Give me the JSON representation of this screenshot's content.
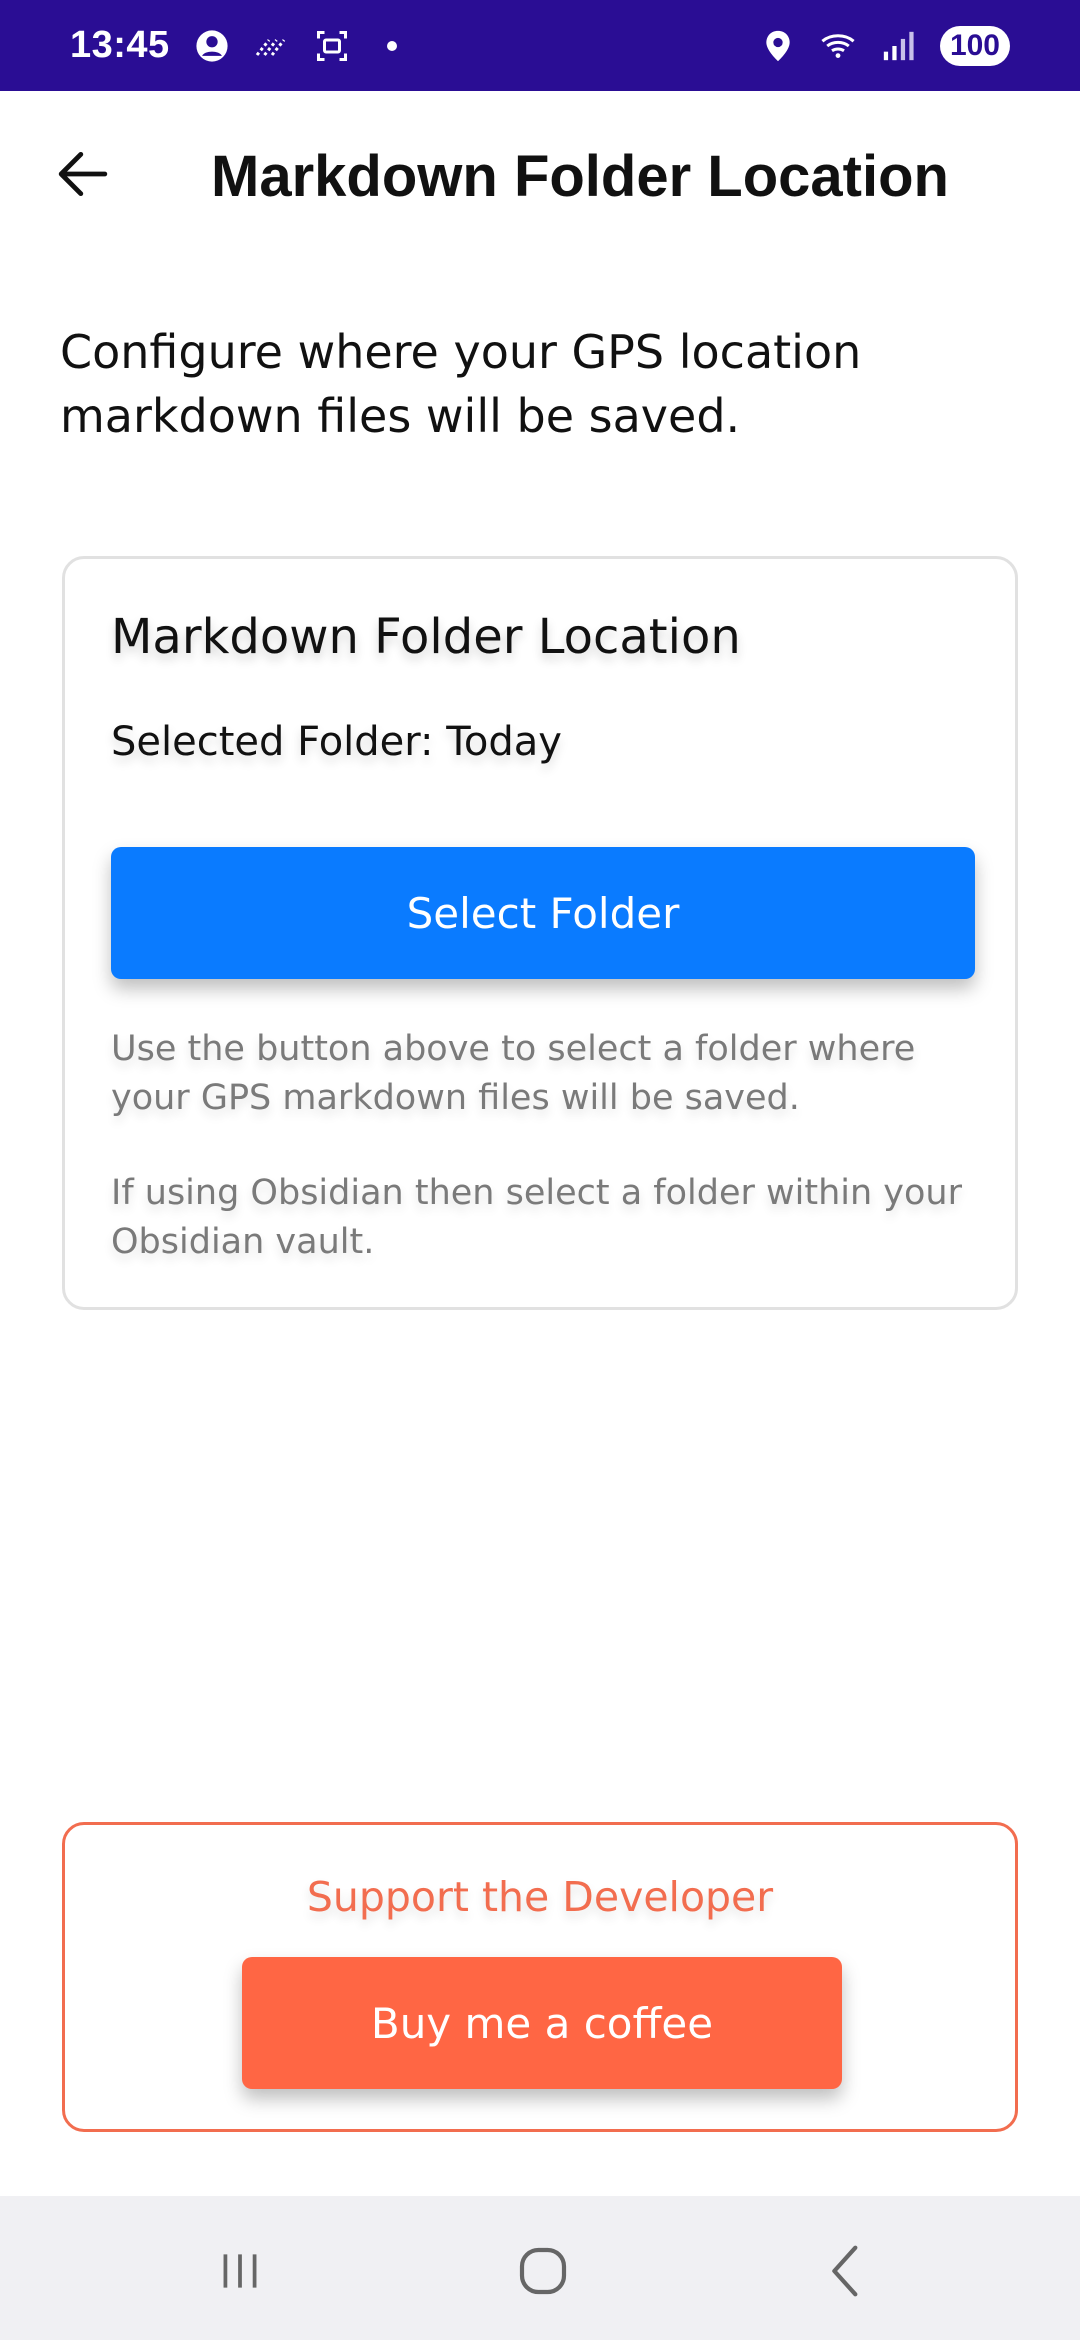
{
  "status_bar": {
    "time": "13:45",
    "battery": "100",
    "icons": [
      "account-circle-icon",
      "wifi-calling-icon",
      "screenshot-icon",
      "dot-icon",
      "location-icon",
      "wifi-icon",
      "signal-icon"
    ]
  },
  "header": {
    "title": "Markdown Folder Location",
    "back_icon": "arrow-left-icon"
  },
  "description": "Configure where your GPS location markdown files will be saved.",
  "card": {
    "title": "Markdown Folder Location",
    "selected_label": "Selected Folder:",
    "selected_value": "Today",
    "select_button_label": "Select Folder",
    "help_1": "Use the button above to select a folder where your GPS markdown files will be saved.",
    "help_2": "If using Obsidian then select a folder within your Obsidian vault.",
    "button_color": "#0a7bff"
  },
  "support": {
    "title": "Support the Developer",
    "button_label": "Buy me a coffee",
    "accent_color": "#ff6644"
  },
  "nav_bar": {
    "icons": [
      "recents-icon",
      "home-icon",
      "back-icon"
    ]
  }
}
